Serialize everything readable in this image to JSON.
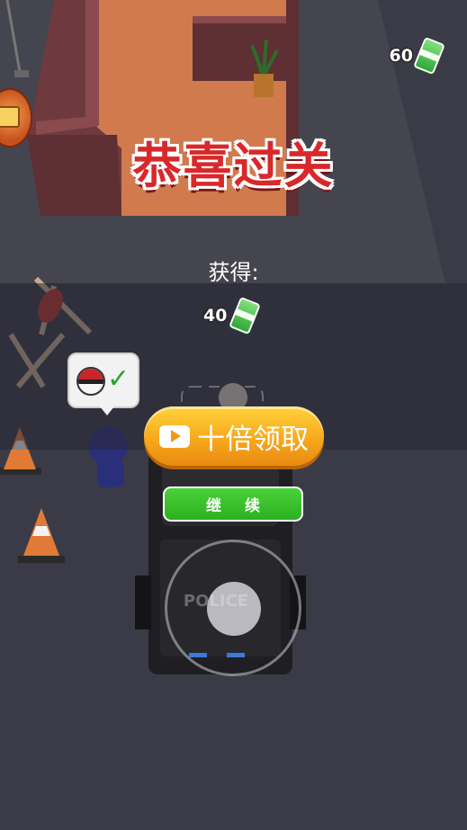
{
  "hud": {
    "currency": "60",
    "currency_icon": "cash-icon"
  },
  "result": {
    "title": "恭喜过关",
    "reward_label": "获得:",
    "reward_amount": "40",
    "reward_icon": "cash-icon"
  },
  "buttons": {
    "ten_times_label": "十倍领取",
    "ten_times_icon": "video-play-icon",
    "continue_label": "继续"
  },
  "scene": {
    "car_text": "POLICE",
    "colors": {
      "floor": "#3a3a44",
      "room_floor": "#d0794e",
      "wall": "#7a3f44",
      "primary_button": "#f6a51b",
      "continue_button": "#2cb021",
      "title_red": "#d8282a"
    }
  }
}
